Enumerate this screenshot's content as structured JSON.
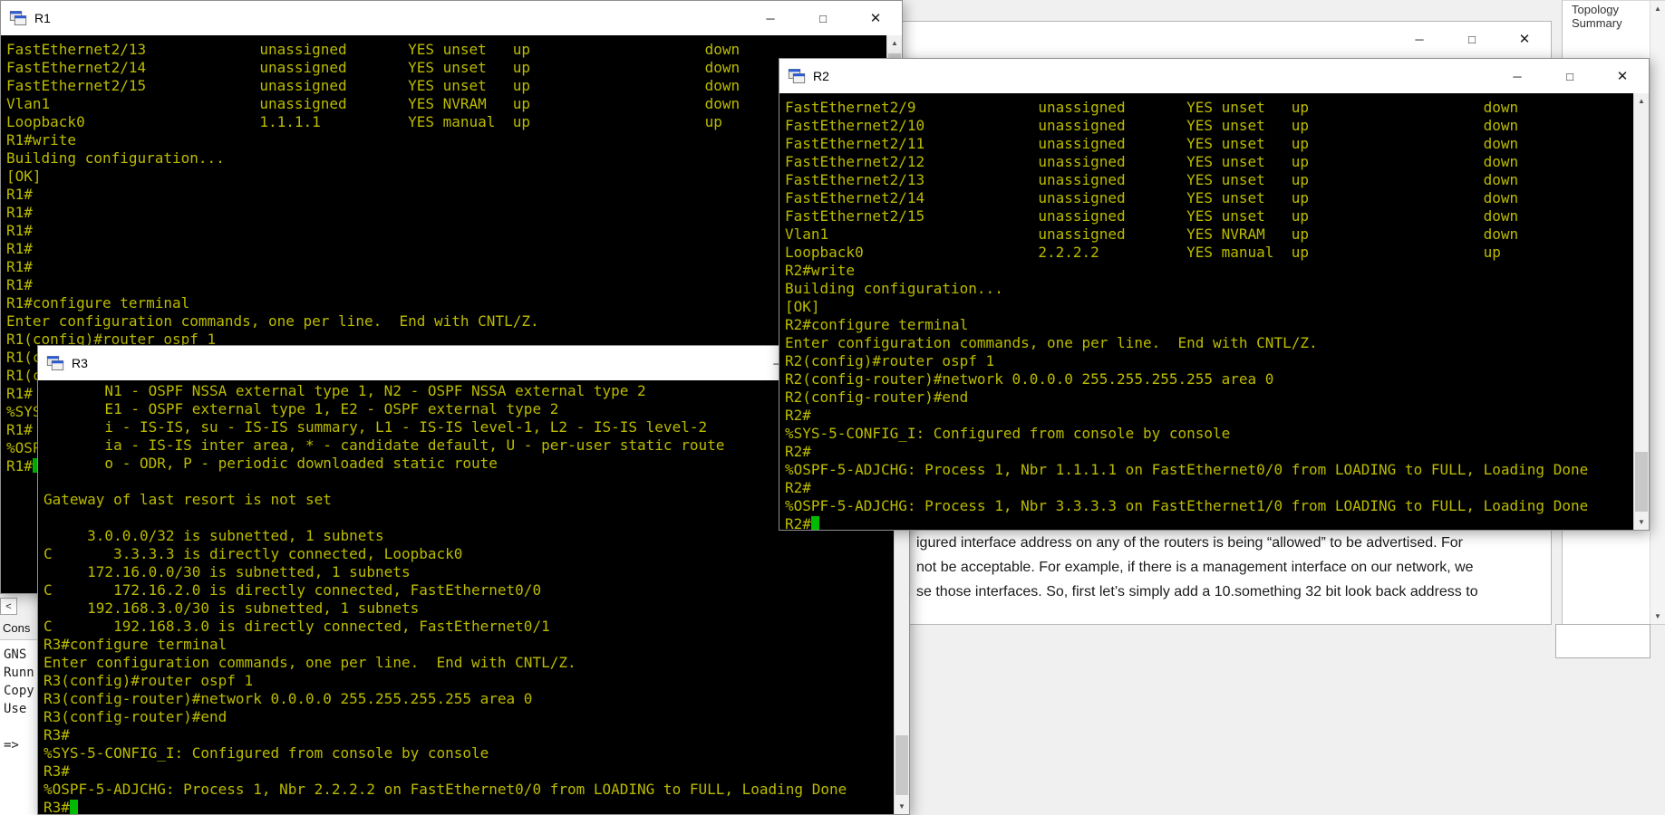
{
  "desktop": {
    "bg_color": "#f0f0f0"
  },
  "terminal": {
    "fg_color": "#bbbb00",
    "bg_color": "#000000",
    "cursor_color": "#00bb00"
  },
  "icons": {
    "minimize": "─",
    "maximize": "□",
    "close": "✕",
    "scroll_up": "▲",
    "scroll_down": "▼",
    "dock_scroll_left": "<"
  },
  "windows": {
    "r1": {
      "title": "R1",
      "cursor_line": 23,
      "lines": [
        "FastEthernet2/13             unassigned       YES unset   up                    down",
        "FastEthernet2/14             unassigned       YES unset   up                    down",
        "FastEthernet2/15             unassigned       YES unset   up                    down",
        "Vlan1                        unassigned       YES NVRAM   up                    down",
        "Loopback0                    1.1.1.1          YES manual  up                    up",
        "R1#write",
        "Building configuration...",
        "[OK]",
        "R1#",
        "R1#",
        "R1#",
        "R1#",
        "R1#",
        "R1#",
        "R1#configure terminal",
        "Enter configuration commands, one per line.  End with CNTL/Z.",
        "R1(config)#router ospf 1",
        "R1(c",
        "R1(c",
        "R1#",
        "%SYS",
        "R1#",
        "%OSP",
        "R1#"
      ]
    },
    "r2": {
      "title": "R2",
      "cursor_line": 23,
      "lines": [
        "FastEthernet2/9              unassigned       YES unset   up                    down",
        "FastEthernet2/10             unassigned       YES unset   up                    down",
        "FastEthernet2/11             unassigned       YES unset   up                    down",
        "FastEthernet2/12             unassigned       YES unset   up                    down",
        "FastEthernet2/13             unassigned       YES unset   up                    down",
        "FastEthernet2/14             unassigned       YES unset   up                    down",
        "FastEthernet2/15             unassigned       YES unset   up                    down",
        "Vlan1                        unassigned       YES NVRAM   up                    down",
        "Loopback0                    2.2.2.2          YES manual  up                    up",
        "R2#write",
        "Building configuration...",
        "[OK]",
        "R2#configure terminal",
        "Enter configuration commands, one per line.  End with CNTL/Z.",
        "R2(config)#router ospf 1",
        "R2(config-router)#network 0.0.0.0 255.255.255.255 area 0",
        "R2(config-router)#end",
        "R2#",
        "%SYS-5-CONFIG_I: Configured from console by console",
        "R2#",
        "%OSPF-5-ADJCHG: Process 1, Nbr 1.1.1.1 on FastEthernet0/0 from LOADING to FULL, Loading Done",
        "R2#",
        "%OSPF-5-ADJCHG: Process 1, Nbr 3.3.3.3 on FastEthernet1/0 from LOADING to FULL, Loading Done",
        "R2#"
      ]
    },
    "r3": {
      "title": "R3",
      "cursor_line": 23,
      "lines": [
        "       N1 - OSPF NSSA external type 1, N2 - OSPF NSSA external type 2",
        "       E1 - OSPF external type 1, E2 - OSPF external type 2",
        "       i - IS-IS, su - IS-IS summary, L1 - IS-IS level-1, L2 - IS-IS level-2",
        "       ia - IS-IS inter area, * - candidate default, U - per-user static route",
        "       o - ODR, P - periodic downloaded static route",
        "",
        "Gateway of last resort is not set",
        "",
        "     3.0.0.0/32 is subnetted, 1 subnets",
        "C       3.3.3.3 is directly connected, Loopback0",
        "     172.16.0.0/30 is subnetted, 1 subnets",
        "C       172.16.2.0 is directly connected, FastEthernet0/0",
        "     192.168.3.0/30 is subnetted, 1 subnets",
        "C       192.168.3.0 is directly connected, FastEthernet0/1",
        "R3#configure terminal",
        "Enter configuration commands, one per line.  End with CNTL/Z.",
        "R3(config)#router ospf 1",
        "R3(config-router)#network 0.0.0.0 255.255.255.255 area 0",
        "R3(config-router)#end",
        "R3#",
        "%SYS-5-CONFIG_I: Configured from console by console",
        "R3#",
        "%OSPF-5-ADJCHG: Process 1, Nbr 2.2.2.2 on FastEthernet0/0 from LOADING to FULL, Loading Done",
        "R3#"
      ]
    }
  },
  "topology_panel": {
    "title": "Topology Summary"
  },
  "document": {
    "lines": [
      "igured interface address on any of the routers is being “allowed” to be advertised.  For",
      "not be acceptable.  For example, if there is a management interface on our network, we",
      "se those interfaces.  So, first let’s simply add a 10.something 32 bit look back address to"
    ]
  },
  "console_dock": {
    "panel_title": "Cons",
    "lines": [
      "GNS",
      "Runn",
      "Copy",
      "Use"
    ],
    "prompt": "=>"
  }
}
